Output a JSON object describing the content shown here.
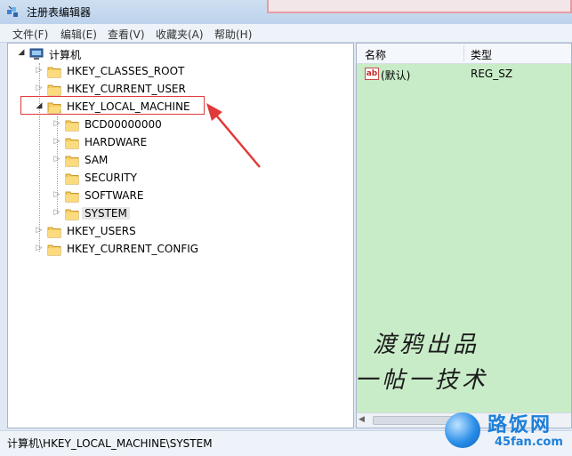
{
  "window": {
    "title": "注册表编辑器"
  },
  "menu": [
    "文件(F)",
    "编辑(E)",
    "查看(V)",
    "收藏夹(A)",
    "帮助(H)"
  ],
  "tree": {
    "root": "计算机",
    "hives": [
      {
        "label": "HKEY_CLASSES_ROOT"
      },
      {
        "label": "HKEY_CURRENT_USER"
      },
      {
        "label": "HKEY_LOCAL_MACHINE",
        "expanded": true,
        "highlighted": true,
        "children": [
          "BCD00000000",
          "HARDWARE",
          "SAM",
          "SECURITY",
          "SOFTWARE",
          "SYSTEM"
        ]
      },
      {
        "label": "HKEY_USERS"
      },
      {
        "label": "HKEY_CURRENT_CONFIG"
      }
    ],
    "selected": "SYSTEM"
  },
  "values": {
    "columns": {
      "name": "名称",
      "type": "类型"
    },
    "rows": [
      {
        "name": "(默认)",
        "type": "REG_SZ",
        "icon": "ab-icon"
      }
    ]
  },
  "handwriting": {
    "line1": "渡鸦出品",
    "line2": "一帖一技术"
  },
  "status": {
    "path": "计算机\\HKEY_LOCAL_MACHINE\\SYSTEM"
  },
  "watermark": {
    "name": "路饭网",
    "domain": "45fan.com"
  },
  "colors": {
    "value_pane_bg": "#c9ecc8",
    "highlight_red": "#e23a3a"
  }
}
